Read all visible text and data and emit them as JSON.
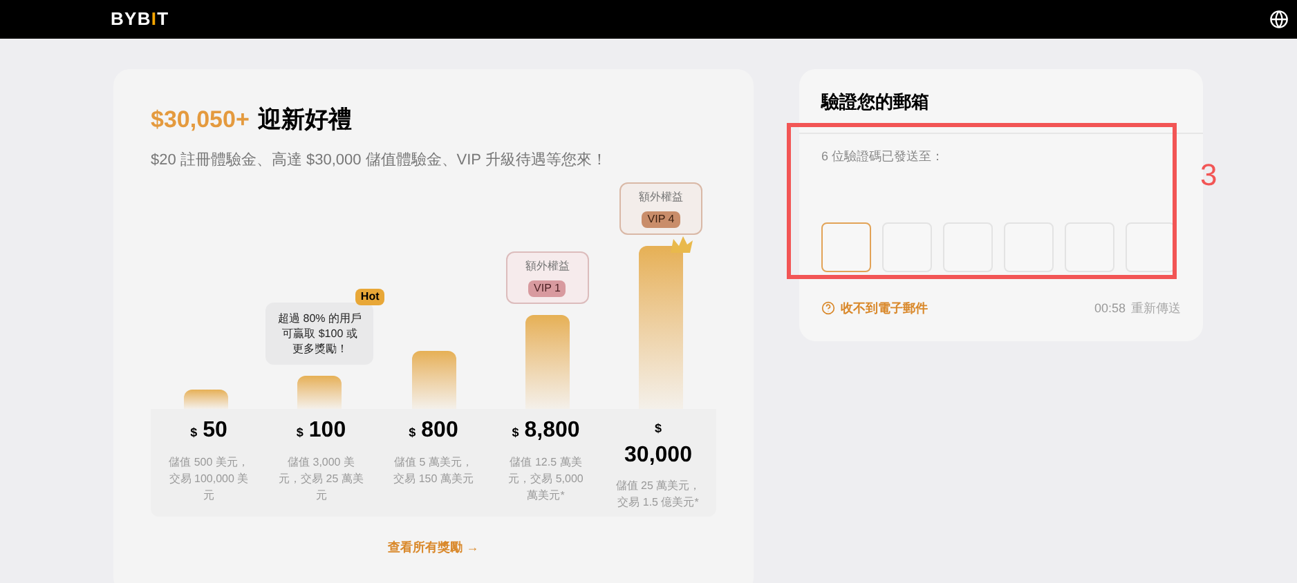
{
  "header": {
    "logo": "BYBIT"
  },
  "promo": {
    "amount": "$30,050+",
    "title": "迎新好禮",
    "subtitle": "$20 註冊體驗金、高達 $30,000 儲值體驗金、VIP 升級待遇等您來！",
    "tiers": [
      {
        "currency": "$",
        "value": "50",
        "desc": "儲值 500 美元，交易 100,000 美元",
        "stacked": false,
        "crown": false
      },
      {
        "currency": "$",
        "value": "100",
        "desc": "儲值 3,000 美元，交易 25 萬美元",
        "stacked": false,
        "crown": false,
        "callout": {
          "kind": "hot",
          "badge": "Hot",
          "text": "超過 80% 的用戶可贏取 $100 或更多獎勵！"
        }
      },
      {
        "currency": "$",
        "value": "800",
        "desc": "儲值 5 萬美元，交易 150 萬美元",
        "stacked": false,
        "crown": false
      },
      {
        "currency": "$",
        "value": "8,800",
        "desc": "儲值 12.5 萬美元，交易 5,000 萬美元*",
        "stacked": false,
        "crown": false,
        "callout": {
          "kind": "vip",
          "label": "額外權益",
          "badge": "VIP 1"
        }
      },
      {
        "currency": "$",
        "value": "30,000",
        "desc": "儲值 25 萬美元，交易 1.5 億美元*",
        "stacked": true,
        "crown": true,
        "callout": {
          "kind": "vip-gold",
          "label": "額外權益",
          "badge": "VIP 4"
        }
      }
    ],
    "link": "查看所有獎勵 →"
  },
  "verify": {
    "title": "驗證您的郵箱",
    "prompt": "6 位驗證碼已發送至：",
    "code_boxes": [
      {
        "selected": true
      },
      {
        "selected": false
      },
      {
        "selected": false
      },
      {
        "selected": false
      },
      {
        "selected": false
      },
      {
        "selected": false
      }
    ],
    "help_link": "收不到電子郵件",
    "timer": "00:58",
    "resend": "重新傳送"
  },
  "annotation": {
    "number": "3"
  }
}
